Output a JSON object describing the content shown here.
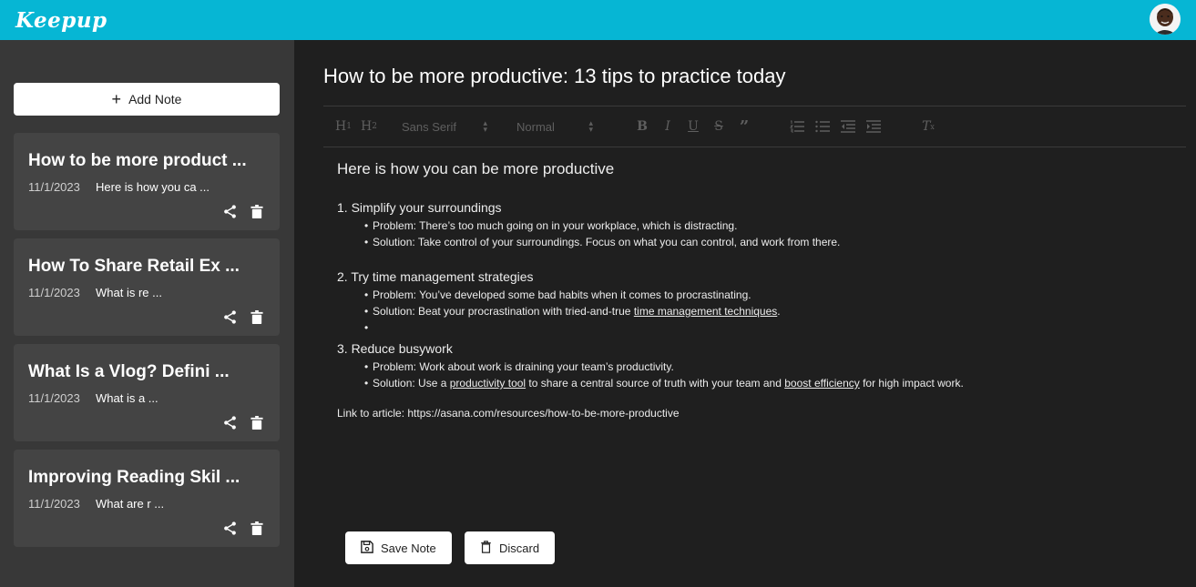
{
  "app": {
    "title": "Keepup"
  },
  "sidebar": {
    "add_note_label": "Add Note",
    "notes": [
      {
        "title": "How to be more product ...",
        "date": "11/1/2023",
        "snippet": "Here is how you ca ..."
      },
      {
        "title": "How To Share Retail Ex ...",
        "date": "11/1/2023",
        "snippet": "What is re ..."
      },
      {
        "title": "What Is a Vlog? Defini ...",
        "date": "11/1/2023",
        "snippet": "What is a ..."
      },
      {
        "title": "Improving Reading Skil ...",
        "date": "11/1/2023",
        "snippet": "What are r ..."
      }
    ]
  },
  "editor": {
    "title": "How to be more productive: 13 tips to practice today",
    "toolbar": {
      "font_family": "Sans Serif",
      "font_size": "Normal"
    },
    "content": {
      "heading": "Here is how you can be more productive",
      "sections": [
        {
          "title": "1. Simplify your surroundings",
          "problem": "Problem: There’s too much going on in your workplace, which is distracting.",
          "solution": "Solution: Take control of your surroundings. Focus on what you can control, and work from there."
        },
        {
          "title": "2. Try time management strategies",
          "problem": "Problem: You’ve developed some bad habits when it comes to procrastinating.",
          "solution_prefix": "Solution: Beat your procrastination with tried-and-true ",
          "solution_link": "time management techniques",
          "solution_suffix": "."
        },
        {
          "title": "3. Reduce busywork",
          "problem": "Problem: Work about work is draining your team’s productivity.",
          "solution_prefix": "Solution: Use a ",
          "solution_link1": "productivity tool",
          "solution_middle": " to share a central source of truth with your team and ",
          "solution_link2": "boost efficiency",
          "solution_suffix": " for high impact work."
        }
      ],
      "article_link": "Link to article: https://asana.com/resources/how-to-be-more-productive"
    },
    "save_label": "Save Note",
    "discard_label": "Discard"
  },
  "colors": {
    "header": "#06b6d4",
    "sidebar": "#383838",
    "card": "#444444",
    "main": "#1f1f1f"
  }
}
